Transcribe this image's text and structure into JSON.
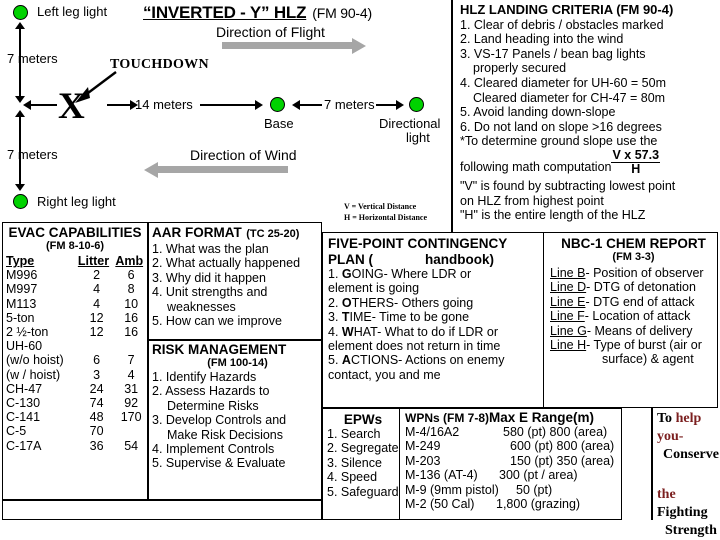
{
  "diagram": {
    "title": "“INVERTED - Y” HLZ",
    "title_ref": "(FM 90-4)",
    "left_leg_light": "Left leg light",
    "right_leg_light": "Right leg light",
    "dist_upper": "7 meters",
    "dist_lower": "7 meters",
    "touchdown": "TOUCHDOWN",
    "x_mark": "X",
    "dist_center": "14 meters",
    "dist_base_to_dir": "7 meters",
    "base_label": "Base",
    "directional_light": "Directional\nlight",
    "directional_light_l1": "Directional",
    "directional_light_l2": "light",
    "direction_of_flight": "Direction of Flight",
    "direction_of_wind": "Direction of Wind",
    "v_def": "V = Vertical Distance",
    "h_def": "H = Horizontal Distance",
    "light_color": "#00d200",
    "arrow_color": "#a6a6a6"
  },
  "hlz_criteria": {
    "heading": "HLZ LANDING CRITERIA (FM 90-4)",
    "items": [
      "1. Clear of debris / obstacles marked",
      "2. Land heading into the wind",
      "3. VS-17 Panels / bean bag lights",
      "properly secured",
      "4. Cleared diameter for UH-60 = 50m",
      "Cleared diameter for CH-47 = 80m",
      "5. Avoid landing down-slope",
      "6. Do not land on slope >16 degrees"
    ],
    "note_line1": "*To determine ground slope use the",
    "note_line2": "following math computation",
    "formula_num": "V x 57.3",
    "formula_den": "H",
    "v_note_1": "\"V\" is found by subtracting lowest point",
    "v_note_2": "on HLZ from highest point",
    "h_note": "\"H\" is the entire length of the HLZ"
  },
  "evac": {
    "title": "EVAC CAPABILITIES",
    "subtitle": "(FM 8-10-6)",
    "headers": [
      "Type",
      "Litter",
      "Amb"
    ],
    "rows": [
      [
        "M996",
        "2",
        "6"
      ],
      [
        "M997",
        "4",
        "8"
      ],
      [
        "M113",
        "4",
        "10"
      ],
      [
        "5-ton",
        "12",
        "16"
      ],
      [
        "2 ½-ton",
        "12",
        "16"
      ],
      [
        "UH-60",
        "",
        ""
      ],
      [
        "(w/o hoist)",
        "6",
        "7"
      ],
      [
        "(w / hoist)",
        "3",
        "4"
      ],
      [
        "CH-47",
        "24",
        "31"
      ],
      [
        "C-130",
        "74",
        "92"
      ],
      [
        "C-141",
        "48",
        "170"
      ],
      [
        "C-5",
        "70",
        ""
      ],
      [
        "C-17A",
        "36",
        "54"
      ]
    ]
  },
  "aar": {
    "title": "AAR FORMAT",
    "ref": "(TC 25-20)",
    "items": [
      "1. What was the plan",
      "2. What actually happened",
      "3. Why did it happen",
      "4. Unit strengths and",
      "weaknesses",
      "5. How can we improve"
    ]
  },
  "risk": {
    "title": "RISK MANAGEMENT",
    "subtitle": "(FM 100-14)",
    "items": [
      "1. Identify Hazards",
      "2. Assess Hazards to",
      "Determine Risks",
      "3. Develop Controls and",
      "Make Risk Decisions",
      "4. Implement Controls",
      "5. Supervise & Evaluate"
    ]
  },
  "contingency": {
    "title_line1": "FIVE-POINT CONTINGENCY",
    "title_line2_a": "PLAN (",
    "title_line2_b": "handbook)",
    "items": [
      {
        "num": "1. ",
        "cap": "G",
        "rest": "OING- Where LDR or"
      },
      {
        "num": "",
        "cap": "",
        "rest": "element is going"
      },
      {
        "num": "2. ",
        "cap": "O",
        "rest": "THERS- Others going"
      },
      {
        "num": "3. ",
        "cap": "T",
        "rest": "IME- Time to be gone"
      },
      {
        "num": "4. ",
        "cap": "W",
        "rest": "HAT- What to do if LDR or"
      },
      {
        "num": "",
        "cap": "",
        "rest": "element does not return in time"
      },
      {
        "num": "5. ",
        "cap": "A",
        "rest": "CTIONS- Actions on enemy"
      },
      {
        "num": "",
        "cap": "",
        "rest": "contact, you and me"
      }
    ]
  },
  "nbc": {
    "title": "NBC-1 CHEM REPORT",
    "subtitle": "(FM 3-3)",
    "lines": [
      {
        "line": "Line B",
        "desc": "- Position of observer"
      },
      {
        "line": "Line D",
        "desc": "- DTG of detonation"
      },
      {
        "line": "Line E",
        "desc": "- DTG end of attack"
      },
      {
        "line": "Line F",
        "desc": "- Location of attack"
      },
      {
        "line": "Line G",
        "desc": "- Means of delivery"
      },
      {
        "line": "Line H",
        "desc": "- Type of burst (air or"
      }
    ],
    "last_cont": "surface) & agent"
  },
  "epws": {
    "title": "EPWs",
    "items": [
      "1. Search",
      "2. Segregate",
      "3. Silence",
      "4. Speed",
      "5. Safeguard"
    ]
  },
  "wpns": {
    "title_a": "WPNs (FM 7-8)",
    "title_b": "Max E Range(m)",
    "rows": [
      {
        "name": "M-4/16A2",
        "range": "580 (pt) 800 (area)"
      },
      {
        "name": "M-249",
        "range": "600 (pt) 800 (area)"
      },
      {
        "name": "M-203",
        "range": "150 (pt) 350 (area)"
      },
      {
        "name": "M-136 (AT-4)",
        "range": "300 (pt / area)"
      },
      {
        "name": "M-9 (9mm pistol)",
        "range": "50 (pt)"
      },
      {
        "name": "M-2 (50 Cal)",
        "range": "1,800 (grazing)"
      }
    ]
  },
  "motto": {
    "l1_a": "To ",
    "l1_b": "help you-",
    "l2": "Conserve",
    "l3_a": "the ",
    "l3_b": "Fighting",
    "l4": "Strength",
    "accent": "#7b1f1f"
  }
}
